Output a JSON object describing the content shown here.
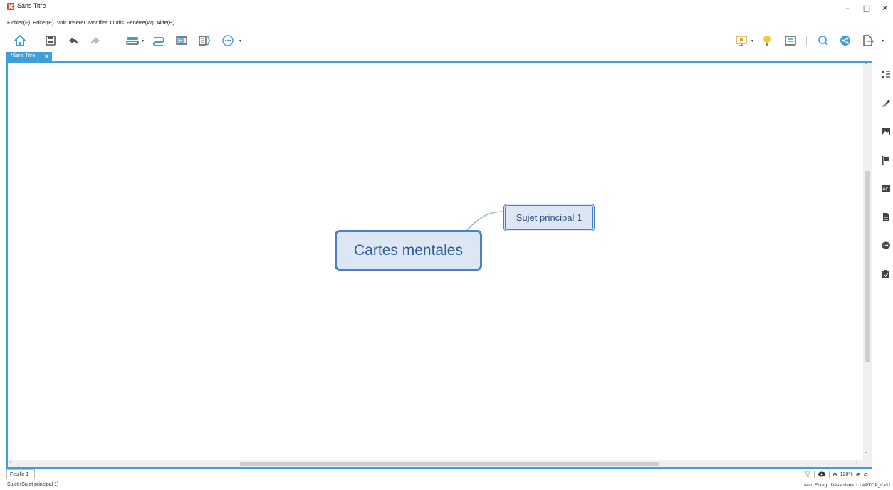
{
  "window": {
    "title": "Sans Titre",
    "minimize": "–",
    "maximize": "□",
    "close": "✕"
  },
  "menu": [
    "Fichier(F)",
    "Editer(E)",
    "Voir",
    "Insérer",
    "Modifier",
    "Outils",
    "Fenêtre(W)",
    "Aide(H)"
  ],
  "toolbar": {
    "left_icons": [
      "home-icon",
      "save-icon",
      "undo-icon",
      "redo-icon",
      "topic-icon",
      "relationship-icon",
      "boundary-icon",
      "summary-icon",
      "more-icon"
    ],
    "right_icons": [
      "presentation-icon",
      "idea-icon",
      "outline-icon",
      "search-icon",
      "share-icon",
      "export-icon"
    ],
    "dropdown_caret": "▾"
  },
  "tabs": [
    {
      "label": "*Sans Titre",
      "close": "×"
    }
  ],
  "mindmap": {
    "central_topic": "Cartes mentales",
    "subtopics": [
      "Sujet principal  1"
    ]
  },
  "side_panel_icons": [
    "outline-panel-icon",
    "format-icon",
    "image-icon",
    "marker-icon",
    "style-icon",
    "notes-icon",
    "comments-icon",
    "task-icon"
  ],
  "sheet": {
    "tab_label": "Feuille 1"
  },
  "zoom": {
    "value": "120%",
    "zoom_out": "⊖",
    "zoom_in": "⊕",
    "fit": "⊜"
  },
  "status": {
    "selection": "Sujet (Sujet principal  1)",
    "autosave": "Auto Enreg.: Désactivée",
    "separator": "•",
    "user": "LAPTOP_CVU"
  },
  "colors": {
    "accent": "#3f9fd8",
    "topic_fill": "#dde7f4",
    "topic_border": "#4c7fc9",
    "topic_text": "#2f5d9a"
  }
}
